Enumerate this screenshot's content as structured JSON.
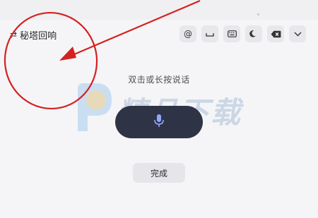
{
  "suggestion": {
    "icon": "shuffle-icon",
    "text": "秘塔回响"
  },
  "toolbar": {
    "items": [
      {
        "name": "at-symbol",
        "label": "@"
      },
      {
        "name": "space-icon",
        "label": ""
      },
      {
        "name": "keyboard-icon",
        "label": ""
      },
      {
        "name": "moon-icon",
        "label": ""
      },
      {
        "name": "backspace-icon",
        "label": ""
      },
      {
        "name": "chevron-down-icon",
        "label": ""
      }
    ]
  },
  "voice": {
    "hint": "双击或长按说话",
    "button_icon": "microphone-icon"
  },
  "done_button": {
    "label": "完成"
  },
  "watermark": {
    "text": "精品下载",
    "url": "jp.com"
  },
  "colors": {
    "annotation_red": "#d42121",
    "voice_button": "#2f3346",
    "panel_bg": "#f5f5f7"
  }
}
